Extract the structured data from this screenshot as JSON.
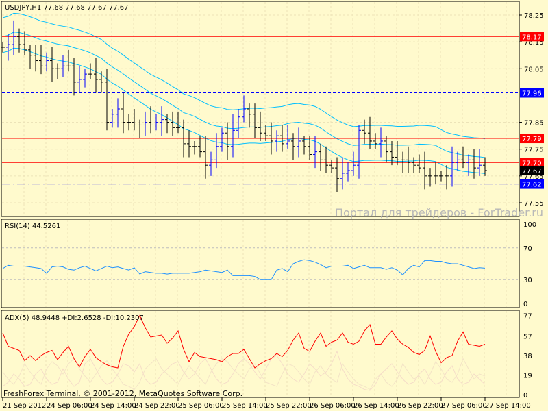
{
  "chart_data": [
    {
      "type": "line",
      "title": "USDJPY,H1",
      "ohlc_readout": "77.68 77.68 77.67 77.67",
      "symbol_label": "USDJPY,H1  77.68 77.68 77.67 77.67",
      "yticks": [
        "78.25",
        "78.15",
        "78.05",
        "77.85",
        "77.75",
        "77.65",
        "77.55"
      ],
      "ylim": [
        77.53,
        78.3
      ],
      "price_lines": [
        {
          "label": "78.17",
          "value": 78.17,
          "color": "#ff0000",
          "style": "solid"
        },
        {
          "label": "77.96",
          "value": 77.96,
          "color": "#0000ff",
          "style": "dashed"
        },
        {
          "label": "77.79",
          "value": 77.79,
          "color": "#ff0000",
          "style": "solid"
        },
        {
          "label": "77.70",
          "value": 77.7,
          "color": "#ff0000",
          "style": "solid"
        },
        {
          "label": "77.62",
          "value": 77.62,
          "color": "#0000ff",
          "style": "dashdot"
        }
      ],
      "current_price": "77.67",
      "closes": [
        78.13,
        78.14,
        78.17,
        78.14,
        78.12,
        78.1,
        78.08,
        78.06,
        78.08,
        78.05,
        78.05,
        78.06,
        78.06,
        78.0,
        78.01,
        78.03,
        78.03,
        78.01,
        78.0,
        77.85,
        77.88,
        77.9,
        77.85,
        77.85,
        77.84,
        77.84,
        77.85,
        77.84,
        77.85,
        77.86,
        77.85,
        77.83,
        77.83,
        77.77,
        77.76,
        77.76,
        77.74,
        77.69,
        77.71,
        77.76,
        77.81,
        77.76,
        77.82,
        77.87,
        77.9,
        77.88,
        77.83,
        77.81,
        77.8,
        77.78,
        77.8,
        77.77,
        77.78,
        77.76,
        77.78,
        77.76,
        77.73,
        77.74,
        77.71,
        77.69,
        77.68,
        77.64,
        77.66,
        77.67,
        77.69,
        77.82,
        77.81,
        77.78,
        77.77,
        77.78,
        77.74,
        77.72,
        77.71,
        77.71,
        77.7,
        77.69,
        77.68,
        77.65,
        77.65,
        77.65,
        77.65,
        77.65,
        77.7,
        77.71,
        77.7,
        77.71,
        77.68,
        77.69,
        77.67
      ],
      "watermark": "Портал для трейдеров - ForTrader.ru"
    },
    {
      "type": "line",
      "title": "RSI(14) 44.5261",
      "ylim": [
        0,
        100
      ],
      "yticks": [
        "100",
        "70",
        "30",
        "0"
      ],
      "levels": [
        70,
        30
      ],
      "values": [
        44,
        48,
        47,
        47,
        47,
        46,
        45,
        44,
        38,
        46,
        47,
        46,
        43,
        42,
        45,
        47,
        44,
        41,
        44,
        47,
        45,
        46,
        44,
        42,
        45,
        37,
        40,
        39,
        38,
        38,
        37,
        38,
        38,
        38,
        38,
        39,
        40,
        42,
        41,
        40,
        39,
        42,
        35,
        35,
        35,
        35,
        34,
        30,
        30,
        30,
        42,
        44,
        40,
        50,
        53,
        55,
        54,
        52,
        49,
        45,
        47,
        47,
        47,
        48,
        44,
        46,
        48,
        45,
        45,
        45,
        43,
        45,
        42,
        36,
        44,
        48,
        46,
        54,
        54,
        53,
        53,
        51,
        50,
        50,
        48,
        46,
        44,
        45,
        44.5
      ]
    },
    {
      "type": "line",
      "title": "ADX(5) 48.9448 +DI:2.6528 -DI:10.2307",
      "ylim": [
        0,
        77
      ],
      "yticks": [
        "77",
        "57",
        "38",
        "19",
        "0"
      ],
      "adx": [
        60,
        47,
        45,
        43,
        33,
        38,
        33,
        38,
        41,
        43,
        34,
        41,
        47,
        35,
        27,
        37,
        44,
        36,
        32,
        29,
        27,
        26,
        47,
        59,
        66,
        77,
        65,
        56,
        57,
        58,
        50,
        55,
        62,
        44,
        32,
        41,
        37,
        36,
        35,
        34,
        32,
        37,
        40,
        40,
        44,
        35,
        26,
        30,
        33,
        35,
        40,
        37,
        43,
        53,
        60,
        45,
        42,
        52,
        60,
        47,
        51,
        53,
        60,
        51,
        49,
        52,
        62,
        68,
        49,
        49,
        56,
        62,
        54,
        49,
        46,
        41,
        39,
        43,
        57,
        42,
        31,
        36,
        38,
        52,
        61,
        49,
        48,
        47,
        49
      ],
      "plus_di": [
        22,
        15,
        10,
        18,
        30,
        22,
        15,
        10,
        25,
        32,
        28,
        20,
        30,
        35,
        25,
        18,
        12,
        20,
        28,
        33,
        25,
        18,
        10,
        8,
        5,
        12,
        25,
        30,
        35,
        25,
        20,
        15,
        10,
        20,
        28,
        22,
        16,
        10,
        22,
        30,
        35,
        32,
        25,
        20,
        15,
        25,
        30,
        20,
        12,
        10,
        8,
        20,
        30,
        28,
        22,
        15,
        10,
        22,
        28,
        20,
        15,
        12,
        30,
        22,
        15,
        10,
        8,
        5,
        15,
        20,
        12,
        8,
        15,
        30,
        22,
        15,
        18,
        10,
        20,
        32,
        25,
        15,
        12,
        20,
        35,
        25,
        15,
        20,
        18
      ],
      "minus_di": [
        8,
        12,
        20,
        15,
        8,
        10,
        20,
        25,
        15,
        10,
        12,
        25,
        15,
        8,
        12,
        30,
        35,
        25,
        15,
        10,
        12,
        20,
        30,
        28,
        22,
        30,
        15,
        10,
        12,
        20,
        25,
        30,
        32,
        22,
        15,
        20,
        30,
        35,
        25,
        15,
        10,
        12,
        20,
        30,
        35,
        30,
        22,
        15,
        25,
        35,
        38,
        30,
        20,
        15,
        12,
        20,
        30,
        25,
        18,
        22,
        30,
        42,
        25,
        15,
        10,
        8,
        5,
        4,
        10,
        20,
        25,
        30,
        22,
        15,
        10,
        12,
        20,
        25,
        15,
        10,
        12,
        22,
        28,
        15,
        10,
        12,
        20,
        15,
        10
      ]
    }
  ],
  "time_labels": [
    "21 Sep 2012",
    "24 Sep 06:00",
    "24 Sep 14:00",
    "24 Sep 22:00",
    "25 Sep 06:00",
    "25 Sep 14:00",
    "25 Sep 22:00",
    "26 Sep 06:00",
    "26 Sep 14:00",
    "26 Sep 22:00",
    "27 Sep 06:00",
    "27 Sep 14:00"
  ],
  "footer": "FreshForex Terminal, © 2001-2012, MetaQuotes Software Corp.",
  "colors": {
    "background": "#fffacd",
    "bands": "#00bfff",
    "rsi": "#1e90ff",
    "adx": "#ff0000",
    "di": "#f5dcc8",
    "grid": "#e6dcb0"
  }
}
